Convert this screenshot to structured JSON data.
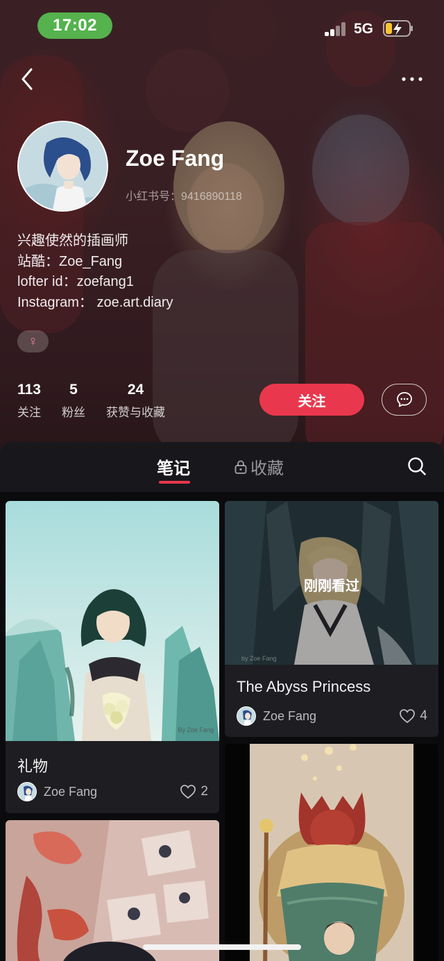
{
  "status_bar": {
    "time": "17:02",
    "network": "5G",
    "colors": {
      "time_pill": "#55b24d"
    }
  },
  "profile": {
    "name": "Zoe Fang",
    "id_label": "小红书号：9416890118",
    "bio": [
      "兴趣使然的插画师",
      "站酷：Zoe_Fang",
      "lofter id：zoefang1",
      "Instagram： zoe.art.diary"
    ],
    "gender_icon": "female-symbol",
    "gender_symbol": "♀",
    "stats": [
      {
        "value": "113",
        "label": "关注"
      },
      {
        "value": "5",
        "label": "粉丝"
      },
      {
        "value": "24",
        "label": "获赞与收藏"
      }
    ],
    "follow_label": "关注",
    "accent_color": "#e9384d"
  },
  "tabs": {
    "notes": "笔记",
    "collections": "收藏"
  },
  "feed": {
    "cards": [
      {
        "title": "礼物",
        "author": "Zoe Fang",
        "likes": "2",
        "signature": "By Zoe Fang"
      },
      {
        "title": "The Abyss Princess",
        "author": "Zoe Fang",
        "likes": "4",
        "overlay": "刚刚看过",
        "signature": "by Zoe Fang"
      }
    ]
  }
}
